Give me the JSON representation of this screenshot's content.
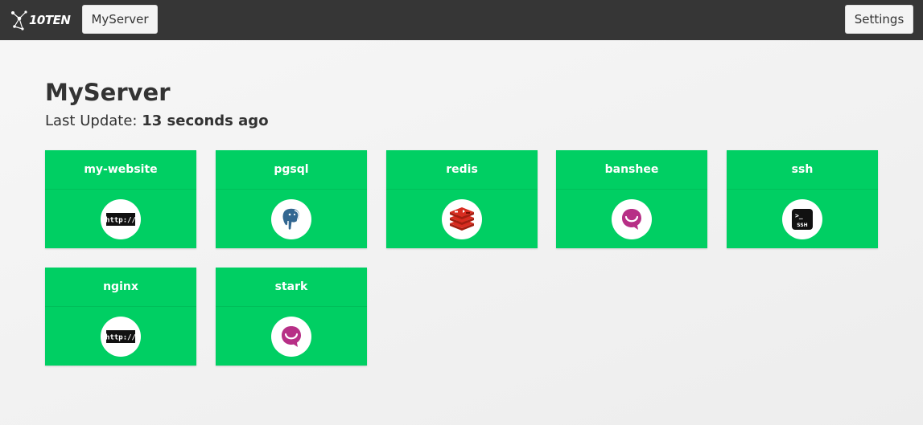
{
  "topbar": {
    "logo_text": "10TEN",
    "server_button": "MyServer",
    "settings_button": "Settings"
  },
  "main": {
    "title": "MyServer",
    "last_update_label": "Last Update:",
    "last_update_value": "13 seconds ago"
  },
  "services": [
    {
      "name": "my-website",
      "icon": "http-icon"
    },
    {
      "name": "pgsql",
      "icon": "postgresql-elephant-icon"
    },
    {
      "name": "redis",
      "icon": "redis-icon"
    },
    {
      "name": "banshee",
      "icon": "banshee-smile-icon"
    },
    {
      "name": "ssh",
      "icon": "ssh-terminal-icon"
    },
    {
      "name": "nginx",
      "icon": "http-icon"
    },
    {
      "name": "stark",
      "icon": "banshee-smile-icon"
    }
  ],
  "colors": {
    "topbar": "#363636",
    "card": "#00cf63",
    "background": "#f2f2f2"
  }
}
